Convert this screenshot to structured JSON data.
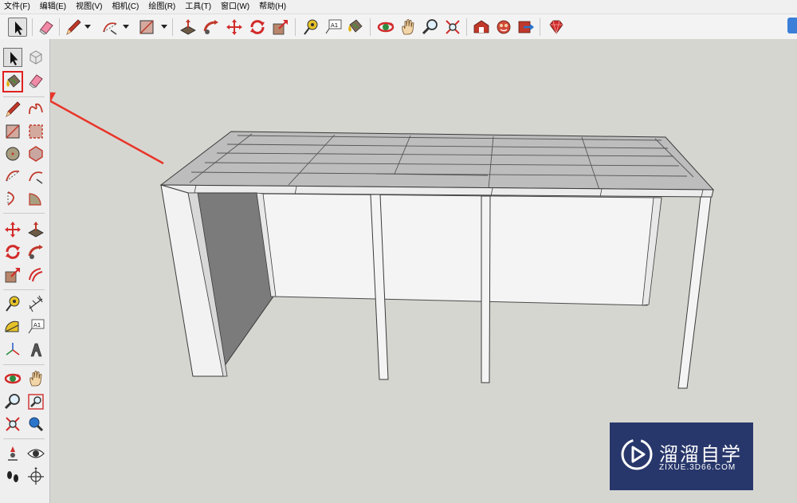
{
  "menu": {
    "items": [
      {
        "label": "文件(F)"
      },
      {
        "label": "编辑(E)"
      },
      {
        "label": "视图(V)"
      },
      {
        "label": "相机(C)"
      },
      {
        "label": "绘图(R)"
      },
      {
        "label": "工具(T)"
      },
      {
        "label": "窗口(W)"
      },
      {
        "label": "帮助(H)"
      }
    ]
  },
  "toolbar": {
    "text_tool_label": "A1"
  },
  "palette": {
    "text_tool_label": "A1"
  },
  "watermark": {
    "name": "溜溜自学",
    "url": "ZIXUE.3D66.COM"
  },
  "colors": {
    "highlight": "#e02020",
    "arrow": "#e8362a",
    "viewport_bg": "#d6d6d1",
    "watermark_bg": "#28376b"
  }
}
